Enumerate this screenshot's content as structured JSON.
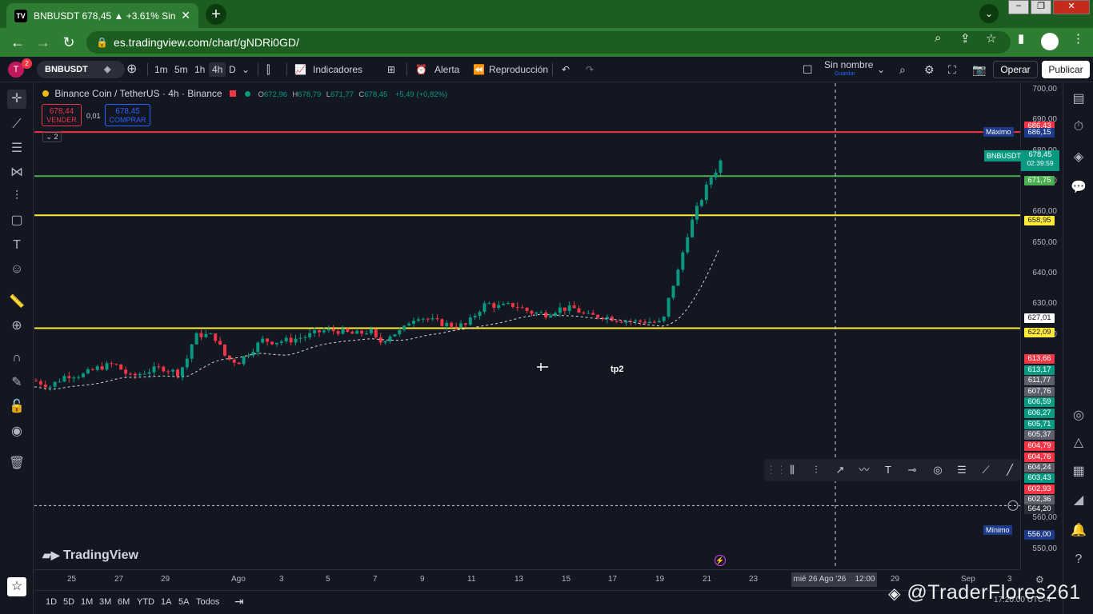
{
  "browser": {
    "tab_title": "BNBUSDT 678,45 ▲ +3.61% Sin n",
    "tab_favicon": "TV",
    "url": "es.tradingview.com/chart/gNDRi0GD/"
  },
  "topbar": {
    "avatar_letter": "T",
    "avatar_badge": "2",
    "symbol": "BNBUSDT",
    "timeframes": [
      "1m",
      "5m",
      "1h",
      "4h",
      "D"
    ],
    "active_timeframe": "4h",
    "indicators": "Indicadores",
    "alert": "Alerta",
    "replay": "Reproducción",
    "layout_name": "Sin nombre",
    "layout_save": "Guardar",
    "operar": "Operar",
    "publicar": "Publicar"
  },
  "legend": {
    "title": "Binance Coin / TetherUS · 4h · Binance",
    "o_label": "O",
    "o": "672,96",
    "h_label": "H",
    "h": "678,79",
    "l_label": "L",
    "l": "671,77",
    "c_label": "C",
    "c": "678,45",
    "change": "+5,49 (+0,82%)",
    "sell_price": "678,44",
    "sell_label": "VENDER",
    "spread": "0,01",
    "buy_price": "678,45",
    "buy_label": "COMPRAR",
    "collapse": "2"
  },
  "price_axis": {
    "labels": [
      "700,00",
      "690,00",
      "680,00",
      "670,00",
      "660,00",
      "650,00",
      "640,00",
      "630,00",
      "620,00",
      "560,00",
      "550,00"
    ],
    "badges": [
      {
        "text": "686,43",
        "color": "#f23645"
      },
      {
        "text": "686,15",
        "color": "#1e3a8a"
      },
      {
        "text": "671,75",
        "color": "#4caf50"
      },
      {
        "text": "658,95",
        "color": "#ffeb3b"
      },
      {
        "text": "627,01",
        "color": "#ffffff"
      },
      {
        "text": "622,09",
        "color": "#ffeb3b"
      },
      {
        "text": "613,66",
        "color": "#f23645"
      },
      {
        "text": "613,17",
        "color": "#089981"
      },
      {
        "text": "611,77",
        "color": "#5d606b"
      },
      {
        "text": "607,76",
        "color": "#5d606b"
      },
      {
        "text": "606,59",
        "color": "#089981"
      },
      {
        "text": "606,27",
        "color": "#089981"
      },
      {
        "text": "605,71",
        "color": "#089981"
      },
      {
        "text": "605,37",
        "color": "#5d606b"
      },
      {
        "text": "604,79",
        "color": "#f23645"
      },
      {
        "text": "604,76",
        "color": "#f23645"
      },
      {
        "text": "604,24",
        "color": "#5d606b"
      },
      {
        "text": "603,43",
        "color": "#089981"
      },
      {
        "text": "602,93",
        "color": "#f23645"
      },
      {
        "text": "602,36",
        "color": "#5d606b"
      },
      {
        "text": "564,20",
        "color": "#2a2e39"
      },
      {
        "text": "556,00",
        "color": "#1e3a8a"
      }
    ],
    "current_symbol": "BNBUSDT",
    "current_price": "678,45",
    "countdown": "02:39:59",
    "max_label": "Máximo",
    "min_label": "Mínimo"
  },
  "time_axis": {
    "labels": [
      "25",
      "27",
      "29",
      "Ago",
      "3",
      "5",
      "7",
      "9",
      "11",
      "13",
      "15",
      "17",
      "19",
      "21",
      "23",
      "29",
      "Sep",
      "3"
    ],
    "crosshair_date": "mié 26 Ago '26",
    "crosshair_time": "12:00"
  },
  "chart_annotations": {
    "tp_label": "tp2",
    "watermark": "TradingView"
  },
  "bottombar": {
    "ranges": [
      "1D",
      "5D",
      "1M",
      "3M",
      "6M",
      "YTD",
      "1A",
      "5A",
      "Todos"
    ],
    "clock": "17:20:00 UTC-4"
  },
  "overlay_credit": "@TraderFlores261",
  "colors": {
    "bg": "#131722",
    "up": "#089981",
    "down": "#f23645",
    "yellow": "#ffeb3b",
    "green_line": "#4caf50",
    "red_line": "#f23645"
  },
  "chart_data": {
    "type": "candlestick",
    "levels": [
      {
        "price": 686.15,
        "color": "#f23645"
      },
      {
        "price": 671.75,
        "color": "#4caf50"
      },
      {
        "price": 658.95,
        "color": "#ffeb3b"
      },
      {
        "price": 622.09,
        "color": "#ffeb3b"
      },
      {
        "price": 564.2,
        "color": "#d1d4dc",
        "style": "dashed"
      }
    ],
    "ylim": [
      545,
      705
    ]
  }
}
